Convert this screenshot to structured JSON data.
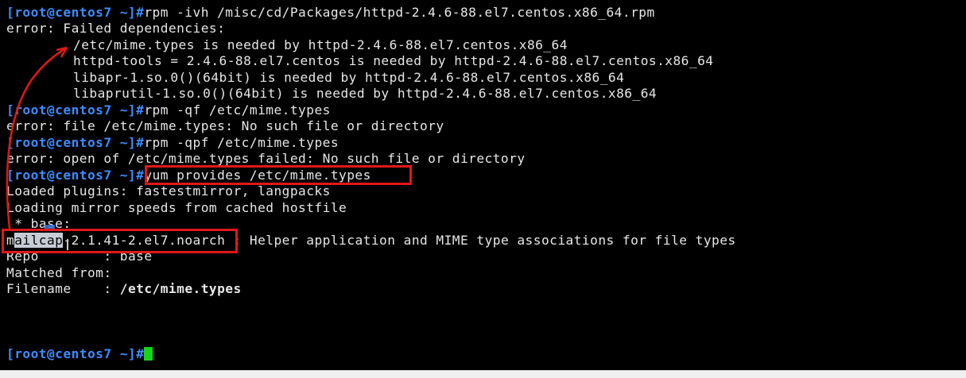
{
  "terminal": {
    "prompt": "[root@centos7 ~]#",
    "cmd1": "rpm -ivh /misc/cd/Packages/httpd-2.4.6-88.el7.centos.x86_64.rpm",
    "err1_header": "error: Failed dependencies:",
    "dep1": "/etc/mime.types is needed by httpd-2.4.6-88.el7.centos.x86_64",
    "dep2": "httpd-tools = 2.4.6-88.el7.centos is needed by httpd-2.4.6-88.el7.centos.x86_64",
    "dep3": "libapr-1.so.0()(64bit) is needed by httpd-2.4.6-88.el7.centos.x86_64",
    "dep4": "libaprutil-1.so.0()(64bit) is needed by httpd-2.4.6-88.el7.centos.x86_64",
    "cmd2": "rpm -qf /etc/mime.types",
    "err2": "error: file /etc/mime.types: No such file or directory",
    "cmd3": "rpm -qpf /etc/mime.types",
    "err3": "error: open of /etc/mime.types failed: No such file or directory",
    "cmd4": "yum provides /etc/mime.types",
    "out1": "Loaded plugins: fastestmirror, langpacks",
    "out2": "Loading mirror speeds from cached hostfile",
    "out3": " * base:",
    "pkg_first": "m",
    "pkg_selected": "ailcap",
    "pkg_rest": "-2.1.41-2.el7.noarch",
    "pkg_desc": " : Helper application and MIME type associations for file types",
    "repo_label": "Repo        : ",
    "repo_value": "base",
    "matched_from": "Matched from:",
    "filename_label": "Filename    : ",
    "filename_value": "/etc/mime.types"
  },
  "colors": {
    "background": "#000000",
    "text": "#e6e6e6",
    "prompt": "#3c8cff",
    "cursor": "#18d418",
    "annotation": "#e01818",
    "selection": "#c8ccd6"
  }
}
